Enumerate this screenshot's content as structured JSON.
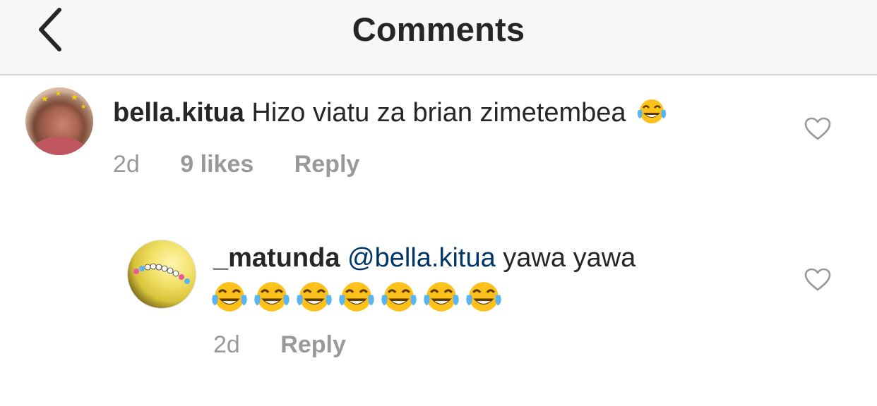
{
  "header": {
    "title": "Comments",
    "back_icon": "chevron-left-icon"
  },
  "comments": [
    {
      "username": "bella.kitua",
      "text": "Hizo viatu za brian zimetembea",
      "emoji": "😂",
      "emoji_count": 1,
      "time": "2d",
      "likes": "9 likes",
      "reply": "Reply",
      "like_icon": "heart-outline-icon"
    },
    {
      "username": "_matunda",
      "mention": "@bella.kitua",
      "text": "yawa yawa",
      "emoji": "😂",
      "emoji_count": 7,
      "time": "2d",
      "reply": "Reply",
      "like_icon": "heart-outline-icon"
    }
  ],
  "colors": {
    "header_bg": "#f7f7f7",
    "text": "#262626",
    "meta": "#999999",
    "mention": "#003569",
    "divider": "#d6d6d6"
  }
}
